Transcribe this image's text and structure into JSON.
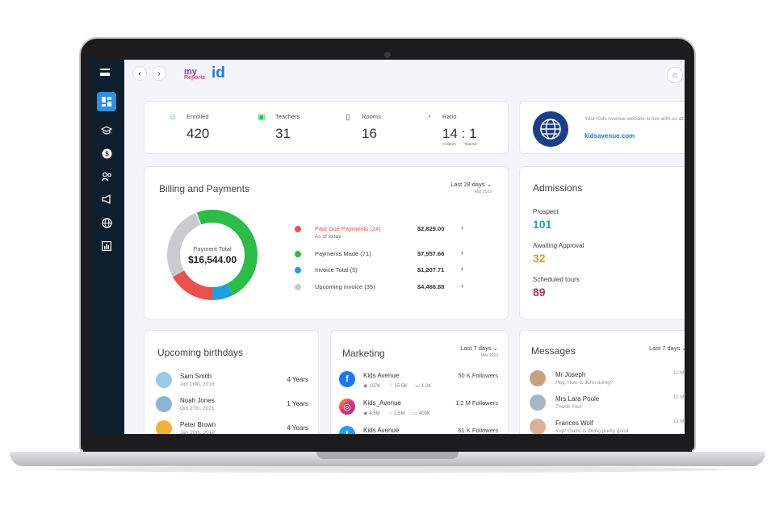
{
  "colors": {
    "sidebar": "#0f1e2c",
    "accent": "#2f8fe0",
    "past_due": "#e8514e",
    "paid": "#2bbd46",
    "invoice": "#1d9fe3",
    "upcoming": "#c9cbce",
    "teal": "#2aa198",
    "orange": "#e29a2d",
    "magenta": "#b0325e",
    "globe": "#1a3f86"
  },
  "sidebar": {
    "items": [
      {
        "icon": "menu-icon"
      },
      {
        "icon": "dashboard-icon",
        "active": true
      },
      {
        "icon": "graduation-cap-icon"
      },
      {
        "icon": "dollar-icon"
      },
      {
        "icon": "users-icon"
      },
      {
        "icon": "megaphone-icon"
      },
      {
        "icon": "globe-icon"
      },
      {
        "icon": "bar-chart-icon"
      }
    ]
  },
  "header": {
    "logo": {
      "my": "my",
      "reports": "Reports",
      "id": "id"
    }
  },
  "stats": {
    "enrolled": {
      "label": "Enrolled",
      "value": "420",
      "icon": "user-add-icon"
    },
    "teachers": {
      "label": "Teachers",
      "value": "31",
      "icon": "chalkboard-icon"
    },
    "rooms": {
      "label": "Rooms",
      "value": "16",
      "icon": "door-icon"
    },
    "ratio": {
      "label": "Ratio",
      "value": "14 : 1",
      "icon": "pie-icon",
      "left_sub": "Children",
      "right_sub": "Teacher"
    }
  },
  "website": {
    "desc": "Your Kids Avenue website is live with us at:",
    "link": "kidsavenue.com"
  },
  "billing": {
    "title": "Billing and Payments",
    "range": "Last 28 days",
    "range_sub": "Mar 2023",
    "center_label": "Payment Total",
    "center_value": "$16,544.00",
    "rows": [
      {
        "label": "Past Due Payments (24)",
        "sub": "As of today",
        "amount": "$2,829.00",
        "share": 0.171
      },
      {
        "label": "Payments Made  (71)",
        "amount": "$7,957.66",
        "share": 0.481
      },
      {
        "label": "Invoice Total (5)",
        "amount": "$1,207.71",
        "share": 0.073
      },
      {
        "label": "Upcoming invoice (35)",
        "amount": "$4,466.88",
        "share": 0.27
      }
    ]
  },
  "admissions": {
    "title": "Admissions",
    "items": [
      {
        "label": "Prospect",
        "value": "101"
      },
      {
        "label": "Awaiting Approval",
        "value": "32"
      },
      {
        "label": "Scheduled tours",
        "value": "89"
      }
    ]
  },
  "birthdays": {
    "title": "Upcoming birthdays",
    "items": [
      {
        "name": "Sam Smith",
        "date": "Apr 18th, 2018",
        "age": "4 Years"
      },
      {
        "name": "Noah Jones",
        "date": "Oct 27th, 2021",
        "age": "1 Years"
      },
      {
        "name": "Peter Brown",
        "date": "Jan 20th, 2019",
        "age": "4 Years"
      }
    ]
  },
  "marketing": {
    "title": "Marketing",
    "range": "Last 7 days",
    "range_sub": "Mar 2023",
    "items": [
      {
        "network": "facebook-icon",
        "glyph": "f",
        "name": "Kids Avenue",
        "followers": "50 K Followers",
        "views": "107K",
        "likes": "15.5K",
        "comments": "1.2K"
      },
      {
        "network": "instagram-icon",
        "glyph": "◎",
        "name": "Kids_Avenue",
        "followers": "1.2 M Followers",
        "views": "4.5M",
        "likes": "1.5M",
        "comments": "400K"
      },
      {
        "network": "twitter-icon",
        "glyph": "t",
        "name": "Kids Avenue",
        "followers": "61 K Followers"
      }
    ]
  },
  "messages": {
    "title": "Messages",
    "range": "Last 7 days",
    "items": [
      {
        "name": "Mr Joseph",
        "text": "Hey, How is John doing?",
        "time": "12 M"
      },
      {
        "name": "Mrs Lara Poole",
        "text": "Thank You!",
        "time": "12 M"
      },
      {
        "name": "Frances Wolf",
        "text": "Yup! Claire is doing pretty good",
        "time": "12 M"
      }
    ]
  }
}
